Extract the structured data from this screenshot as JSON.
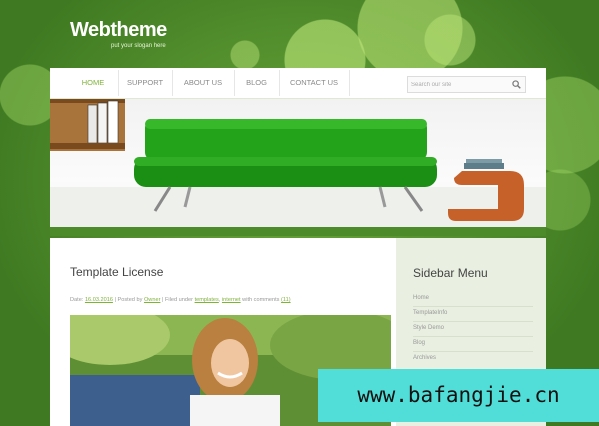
{
  "header": {
    "logo": "Webtheme",
    "slogan": "put your slogan here"
  },
  "nav": {
    "items": [
      "HOME",
      "SUPPORT",
      "ABOUT US",
      "BLOG",
      "CONTACT US"
    ],
    "active": "HOME",
    "search_placeholder": "Search our site"
  },
  "post": {
    "title": "Template License",
    "meta": {
      "date_label": "Date:",
      "date": "16.03.2016",
      "posted_label": "| Posted by",
      "author": "Owner",
      "filed_label": "| Filed under",
      "cat1": "templates",
      "cat2": "internet",
      "comments_label": "with comments",
      "comments": "(11)"
    }
  },
  "sidebar": {
    "title": "Sidebar Menu",
    "items": [
      "Home",
      "TemplateInfo",
      "Style Demo",
      "Blog",
      "Archives"
    ]
  },
  "watermark": "www.bafangjie.cn",
  "colors": {
    "accent": "#7eb33a",
    "background": "#4e8a2c",
    "sofa": "#1f9b16",
    "watermark_bg": "#52ded8"
  }
}
